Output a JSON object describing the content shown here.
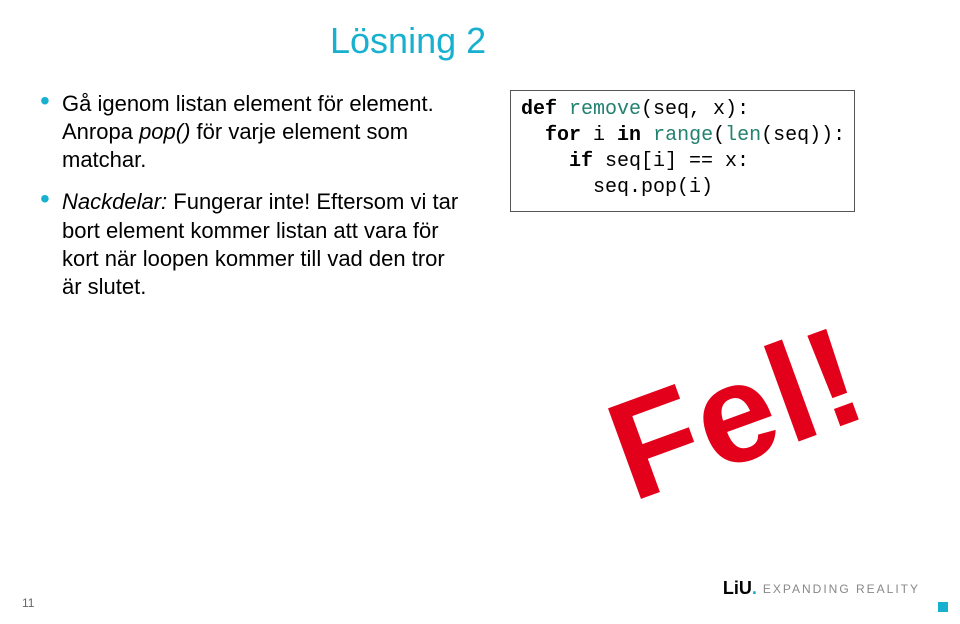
{
  "title": "Lösning 2",
  "bullets": {
    "b1_line1": "Gå igenom listan element för element. Anropa ",
    "b1_italic": "pop()",
    "b1_line2": " för varje element som matchar.",
    "b2_italic": "Nackdelar:",
    "b2_rest": " Fungerar inte! Eftersom vi tar bort element kommer listan att vara för kort när loopen kommer till vad den tror är slutet."
  },
  "code": {
    "def": "def",
    "remove": "remove",
    "arg": "(seq, x):",
    "for": "for",
    "i": " i ",
    "in": "in",
    "range": "range",
    "lparen": "(",
    "len": "len",
    "rest1": "(seq)):",
    "ifkw": "if",
    "cond": " seq[i] == x:",
    "body": "      seq.pop(i)"
  },
  "stamp": "Fel!",
  "footer": {
    "page": "11",
    "liu": "LiU",
    "tagline": "EXPANDING REALITY"
  }
}
